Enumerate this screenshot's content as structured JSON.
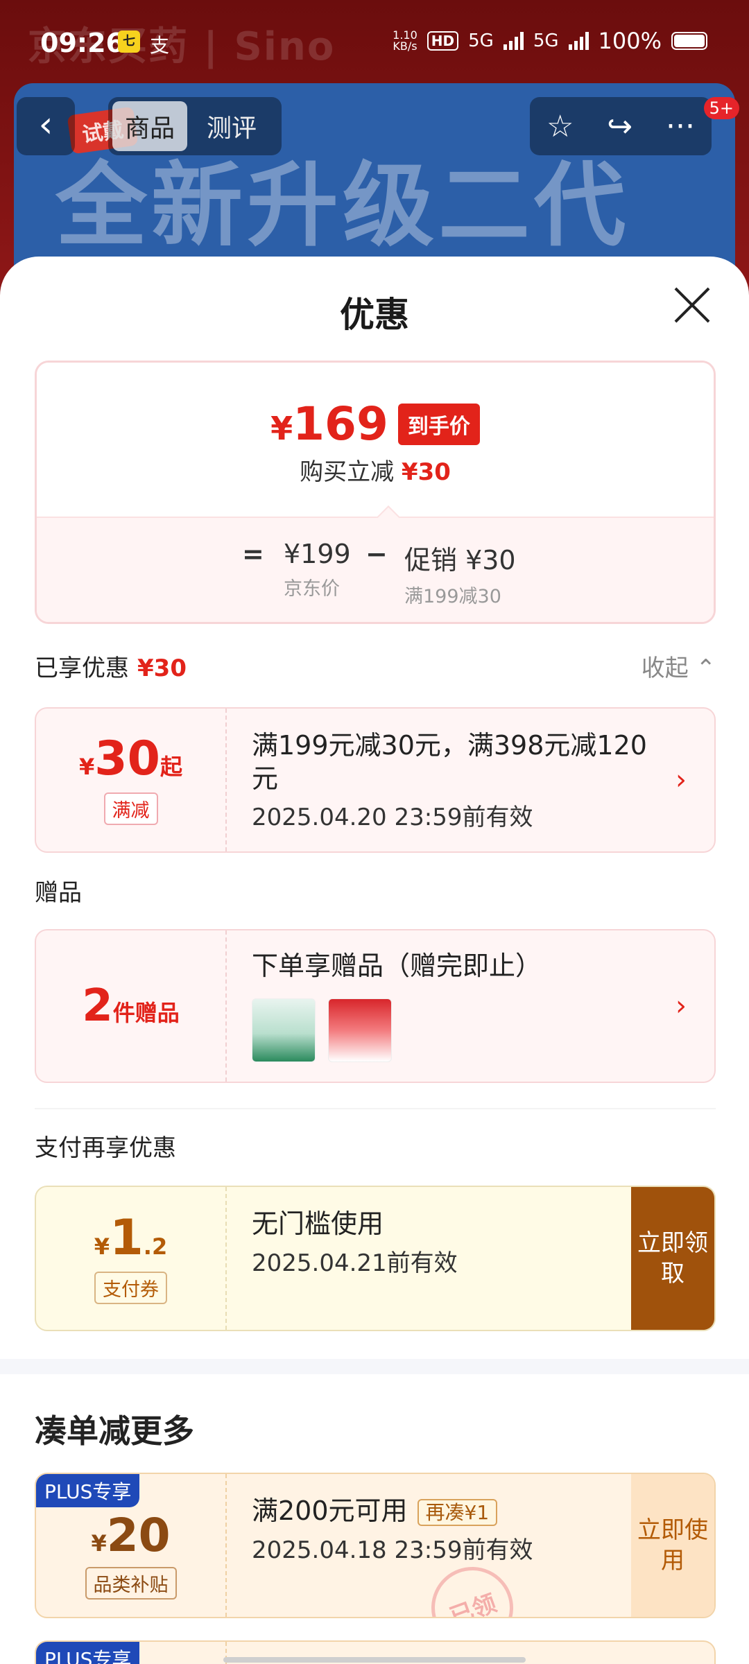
{
  "status_bar": {
    "time": "09:26",
    "app_icon1": "七",
    "app_icon2": "支",
    "net_speed_top": "1.10",
    "net_speed_bottom": "KB/s",
    "hd": "HD",
    "net1": "5G",
    "net2": "5G",
    "battery": "100%"
  },
  "background": {
    "brand": "京东买药 | Sino",
    "banner_tag": "试戴",
    "banner_text": "全新升级二代"
  },
  "nav": {
    "back_icon": "‹",
    "tabs": [
      {
        "label": "商品"
      },
      {
        "label": "测评"
      }
    ],
    "favorite_icon": "☆",
    "share_icon": "↪",
    "more_icon": "···",
    "badge": "5+"
  },
  "sheet": {
    "title": "优惠",
    "price_card": {
      "currency": "¥",
      "final_price": "169",
      "tag": "到手价",
      "sub_prefix": "购买立减",
      "sub_amount": "¥30",
      "equals": "=",
      "base_value": "¥199",
      "base_label": "京东价",
      "minus": "−",
      "promo_value": "促销 ¥30",
      "promo_label": "满199减30"
    },
    "enjoyed": {
      "label": "已享优惠",
      "amount": "¥30",
      "toggle": "收起 ⌃"
    },
    "coupon_discount": {
      "currency": "¥",
      "amount": "30",
      "suffix": "起",
      "tag": "满减",
      "text": "满199元减30元，满398元减120元",
      "date": "2025.04.20 23:59前有效",
      "chevron": "›"
    },
    "gifts_section": {
      "label": "赠品",
      "count": "2",
      "count_suffix": "件赠品",
      "text": "下单享赠品（赠完即止）",
      "chevron": "›"
    },
    "pay_section": {
      "label": "支付再享优惠",
      "currency": "¥",
      "amount_int": "1",
      "amount_dec": ".2",
      "tag": "支付券",
      "text": "无门槛使用",
      "date": "2025.04.21前有效",
      "cta": "立即领取"
    },
    "more_section": {
      "title": "凑单减更多",
      "plus_tag": "PLUS专享",
      "currency": "¥",
      "amount": "20",
      "tag": "品类补贴",
      "text": "满200元可用",
      "mini_tag": "再凑¥1",
      "date": "2025.04.18 23:59前有效",
      "cta": "立即使用",
      "stamp": "已领",
      "next_plus_tag": "PLUS专享"
    }
  }
}
